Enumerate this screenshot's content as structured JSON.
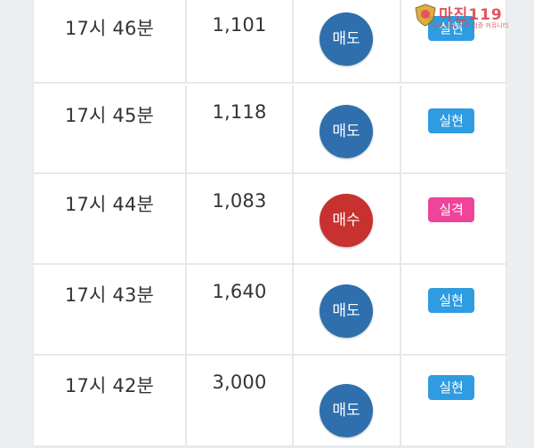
{
  "rows": [
    {
      "time": "17시 46분",
      "qty": "1,101",
      "action": "매도",
      "action_type": "sell",
      "result": "실현",
      "result_type": "ok"
    },
    {
      "time": "17시 45분",
      "qty": "1,118",
      "action": "매도",
      "action_type": "sell",
      "result": "실현",
      "result_type": "ok"
    },
    {
      "time": "17시 44분",
      "qty": "1,083",
      "action": "매수",
      "action_type": "buy",
      "result": "실격",
      "result_type": "fail"
    },
    {
      "time": "17시 43분",
      "qty": "1,640",
      "action": "매도",
      "action_type": "sell",
      "result": "실현",
      "result_type": "ok"
    },
    {
      "time": "17시 42분",
      "qty": "3,000",
      "action": "매도",
      "action_type": "sell",
      "result": "실현",
      "result_type": "ok"
    }
  ],
  "colors": {
    "sell": "#2f6fad",
    "buy": "#c7312f",
    "ok": "#2f9be0",
    "fail": "#f0439a"
  },
  "watermark": {
    "name": "마진119",
    "tagline": "국내 대표 토토 검증 커뮤니티"
  }
}
